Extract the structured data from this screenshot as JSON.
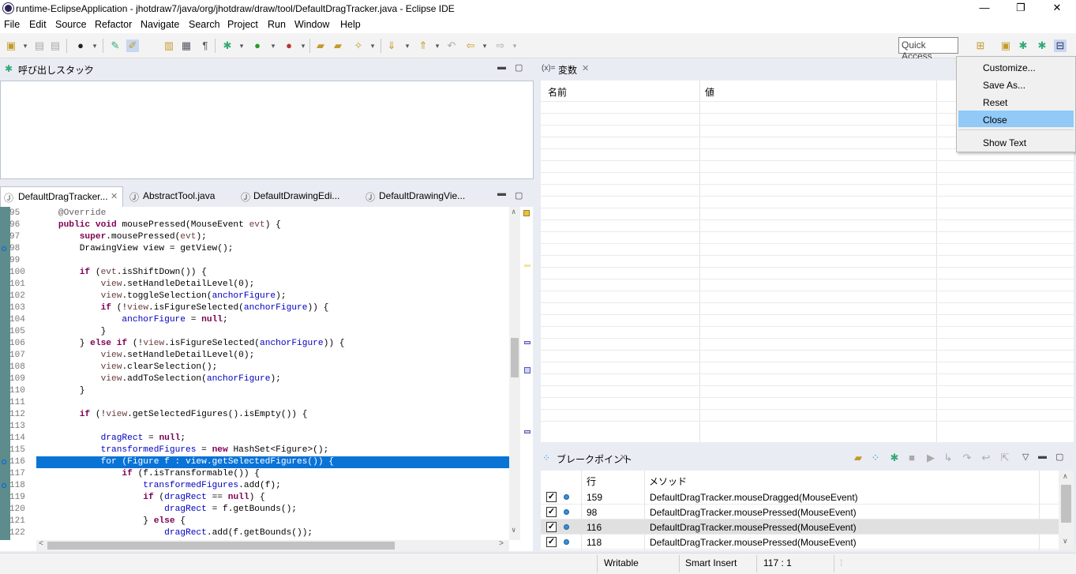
{
  "window": {
    "title": "runtime-EclipseApplication - jhotdraw7/java/org/jhotdraw/draw/tool/DefaultDragTracker.java - Eclipse IDE",
    "minimize": "—",
    "restore": "❐",
    "close": "✕"
  },
  "menubar": [
    "File",
    "Edit",
    "Source",
    "Refactor",
    "Navigate",
    "Search",
    "Project",
    "Run",
    "Window",
    "Help"
  ],
  "toolbar": {
    "quick_access": "Quick Access"
  },
  "callstack": {
    "title": "呼び出しスタック"
  },
  "variables": {
    "title": "変数",
    "prefix": "(x)=",
    "col_name": "名前",
    "col_value": "値"
  },
  "context_menu": {
    "items": [
      "Customize...",
      "Save As...",
      "Reset",
      "Close",
      "Show Text"
    ],
    "selected": "Close"
  },
  "editor": {
    "tabs": [
      "DefaultDragTracker...",
      "AbstractTool.java",
      "DefaultDrawingEdi...",
      "DefaultDrawingVie..."
    ],
    "active_tab": "DefaultDragTracker...",
    "highlight_line": "116",
    "lines": [
      {
        "n": "95",
        "t": "    @Override"
      },
      {
        "n": "96",
        "t": "    public void mousePressed(MouseEvent evt) {"
      },
      {
        "n": "97",
        "t": "        super.mousePressed(evt);"
      },
      {
        "n": "98",
        "t": "        DrawingView view = getView();"
      },
      {
        "n": "99",
        "t": ""
      },
      {
        "n": "100",
        "t": "        if (evt.isShiftDown()) {"
      },
      {
        "n": "101",
        "t": "            view.setHandleDetailLevel(0);"
      },
      {
        "n": "102",
        "t": "            view.toggleSelection(anchorFigure);"
      },
      {
        "n": "103",
        "t": "            if (!view.isFigureSelected(anchorFigure)) {"
      },
      {
        "n": "104",
        "t": "                anchorFigure = null;"
      },
      {
        "n": "105",
        "t": "            }"
      },
      {
        "n": "106",
        "t": "        } else if (!view.isFigureSelected(anchorFigure)) {"
      },
      {
        "n": "107",
        "t": "            view.setHandleDetailLevel(0);"
      },
      {
        "n": "108",
        "t": "            view.clearSelection();"
      },
      {
        "n": "109",
        "t": "            view.addToSelection(anchorFigure);"
      },
      {
        "n": "110",
        "t": "        }"
      },
      {
        "n": "111",
        "t": ""
      },
      {
        "n": "112",
        "t": "        if (!view.getSelectedFigures().isEmpty()) {"
      },
      {
        "n": "113",
        "t": ""
      },
      {
        "n": "114",
        "t": "            dragRect = null;"
      },
      {
        "n": "115",
        "t": "            transformedFigures = new HashSet<Figure>();"
      },
      {
        "n": "116",
        "t": "            for (Figure f : view.getSelectedFigures()) {"
      },
      {
        "n": "117",
        "t": "                if (f.isTransformable()) {"
      },
      {
        "n": "118",
        "t": "                    transformedFigures.add(f);"
      },
      {
        "n": "119",
        "t": "                    if (dragRect == null) {"
      },
      {
        "n": "120",
        "t": "                        dragRect = f.getBounds();"
      },
      {
        "n": "121",
        "t": "                    } else {"
      },
      {
        "n": "122",
        "t": "                        dragRect.add(f.getBounds());"
      }
    ]
  },
  "breakpoints": {
    "title": "ブレークポイント",
    "col_line": "行",
    "col_method": "メソッド",
    "rows": [
      {
        "line": "159",
        "method": "DefaultDragTracker.mouseDragged(MouseEvent)",
        "checked": true
      },
      {
        "line": "98",
        "method": "DefaultDragTracker.mousePressed(MouseEvent)",
        "checked": true
      },
      {
        "line": "116",
        "method": "DefaultDragTracker.mousePressed(MouseEvent)",
        "checked": true
      },
      {
        "line": "118",
        "method": "DefaultDragTracker.mousePressed(MouseEvent)",
        "checked": true
      }
    ]
  },
  "statusbar": {
    "writable": "Writable",
    "insert_mode": "Smart Insert",
    "position": "117 : 1"
  },
  "colors": {
    "selection": "#0a73d6",
    "menu_highlight": "#91c9f7",
    "keyword": "#7f0055",
    "field": "#0000c0"
  }
}
